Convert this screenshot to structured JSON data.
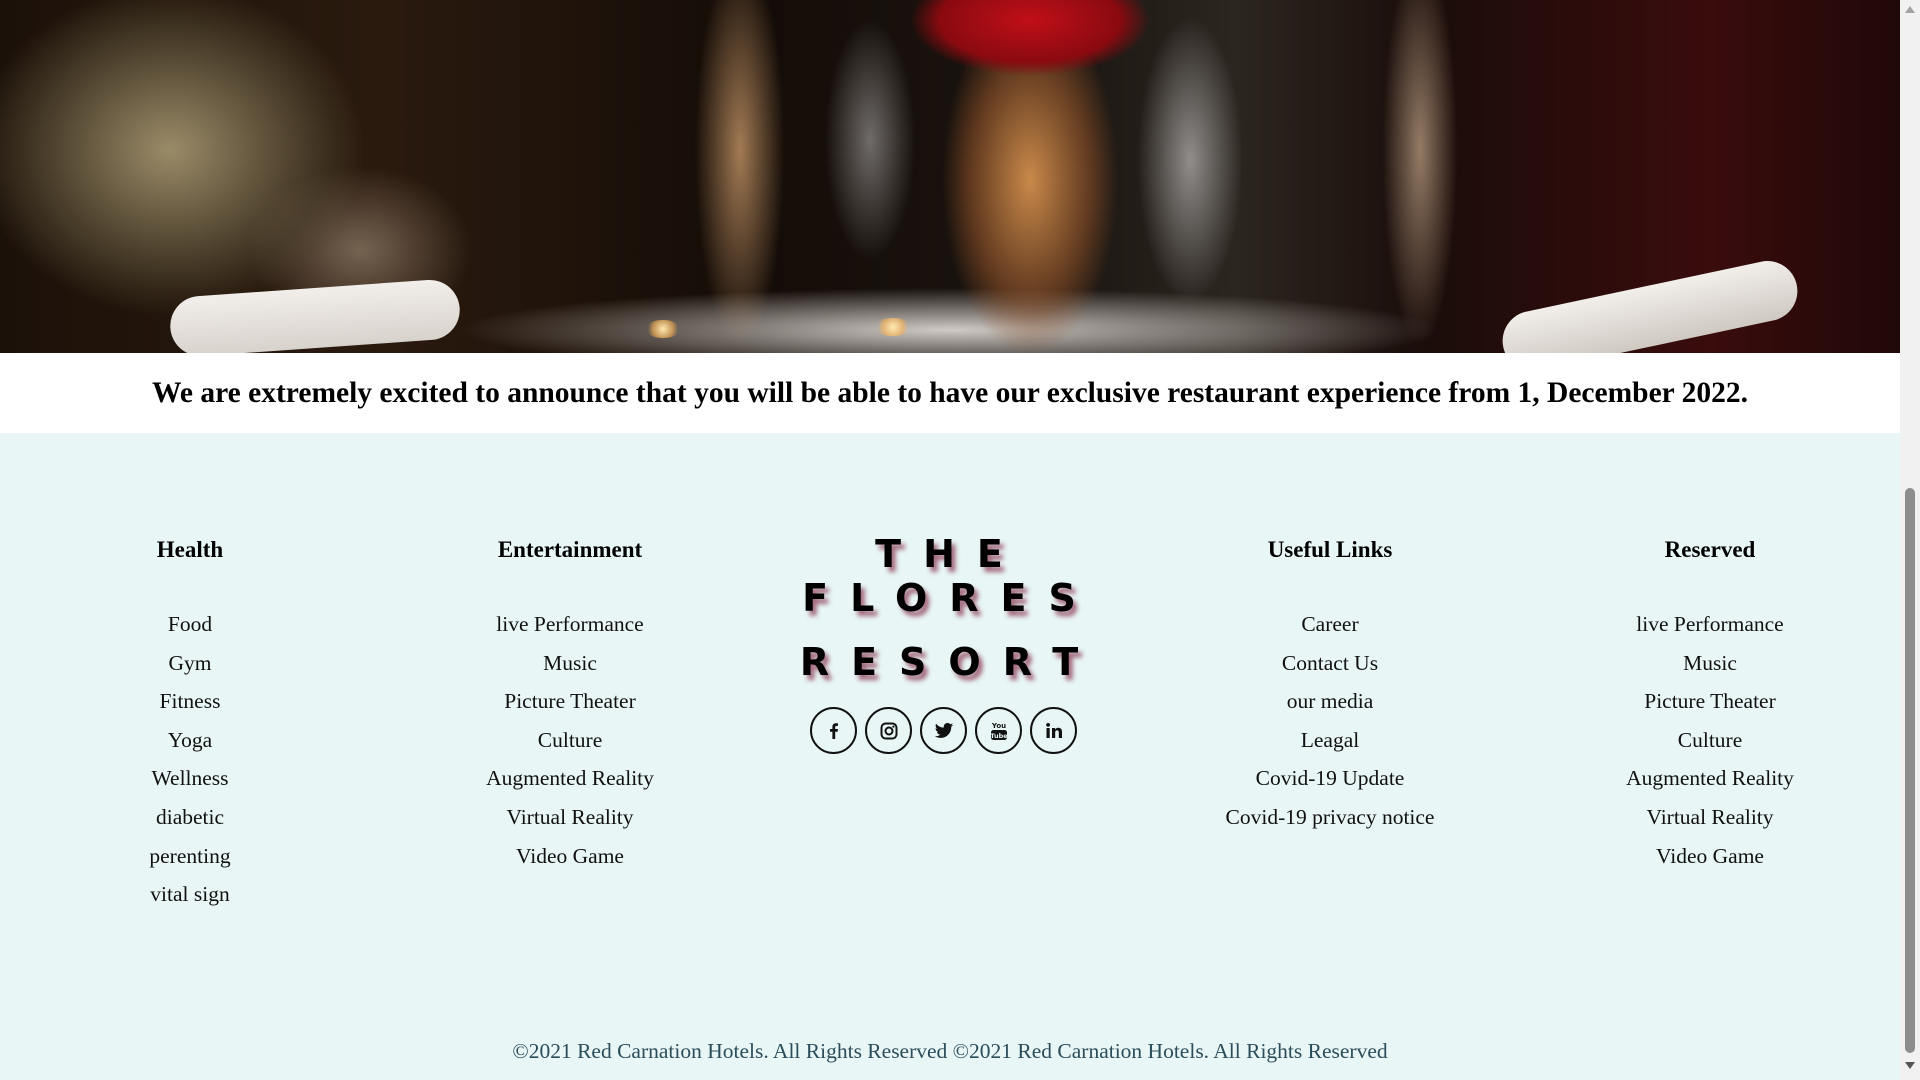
{
  "announcement": "We are extremely excited to announce that you will be able to have our exclusive restaurant experience from 1, December 2022.",
  "footer": {
    "columns": [
      {
        "title": "Health",
        "items": [
          "Food",
          "Gym",
          "Fitness",
          "Yoga",
          "Wellness",
          "diabetic",
          "perenting",
          "vital sign"
        ]
      },
      {
        "title": "Entertainment",
        "items": [
          "live Performance",
          "Music",
          "Picture Theater",
          "Culture",
          "Augmented Reality",
          "Virtual Reality",
          "Video Game"
        ]
      },
      {
        "title": "Useful Links",
        "items": [
          "Career",
          "Contact Us",
          "our media",
          "Leagal",
          "Covid-19 Update",
          "Covid-19 privacy notice"
        ]
      },
      {
        "title": "Reserved",
        "items": [
          "live Performance",
          "Music",
          "Picture Theater",
          "Culture",
          "Augmented Reality",
          "Virtual Reality",
          "Video Game"
        ]
      }
    ],
    "brand": {
      "line1": "THE",
      "line2": "FLORES",
      "line3": "RESORT"
    },
    "social": [
      "facebook-icon",
      "instagram-icon",
      "twitter-icon",
      "youtube-icon",
      "linkedin-icon"
    ],
    "copyright": "©2021 Red Carnation Hotels. All Rights Reserved ©2021 Red Carnation Hotels. All Rights Reserved"
  },
  "colors": {
    "footer_background": "#e8f6f6",
    "brand_shadow": "#a36a7e",
    "copyright_text": "#2b4d5a"
  }
}
